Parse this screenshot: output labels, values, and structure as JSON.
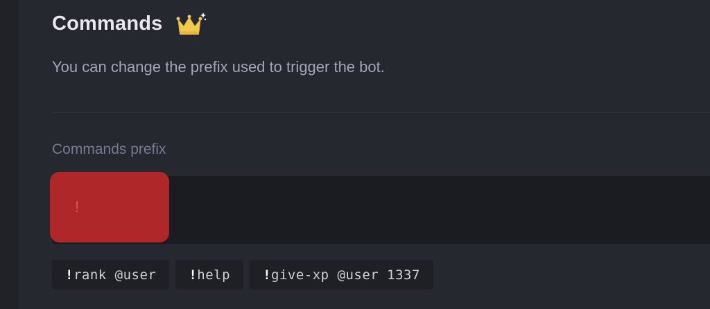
{
  "section": {
    "title": "Commands",
    "title_icon": "crown-icon",
    "description": "You can change the prefix used to trigger the bot."
  },
  "prefix_field": {
    "label": "Commands prefix",
    "value": "!",
    "accent_color": "#b0272a"
  },
  "example_commands": [
    {
      "prefix": "!",
      "text": "rank @user"
    },
    {
      "prefix": "!",
      "text": "help"
    },
    {
      "prefix": "!",
      "text": "give-xp @user 1337"
    }
  ],
  "colors": {
    "background": "#26282f",
    "title": "#e8e9ee",
    "description": "#a2a6b8",
    "label": "#767b8f",
    "crown": "#f2c94c"
  }
}
